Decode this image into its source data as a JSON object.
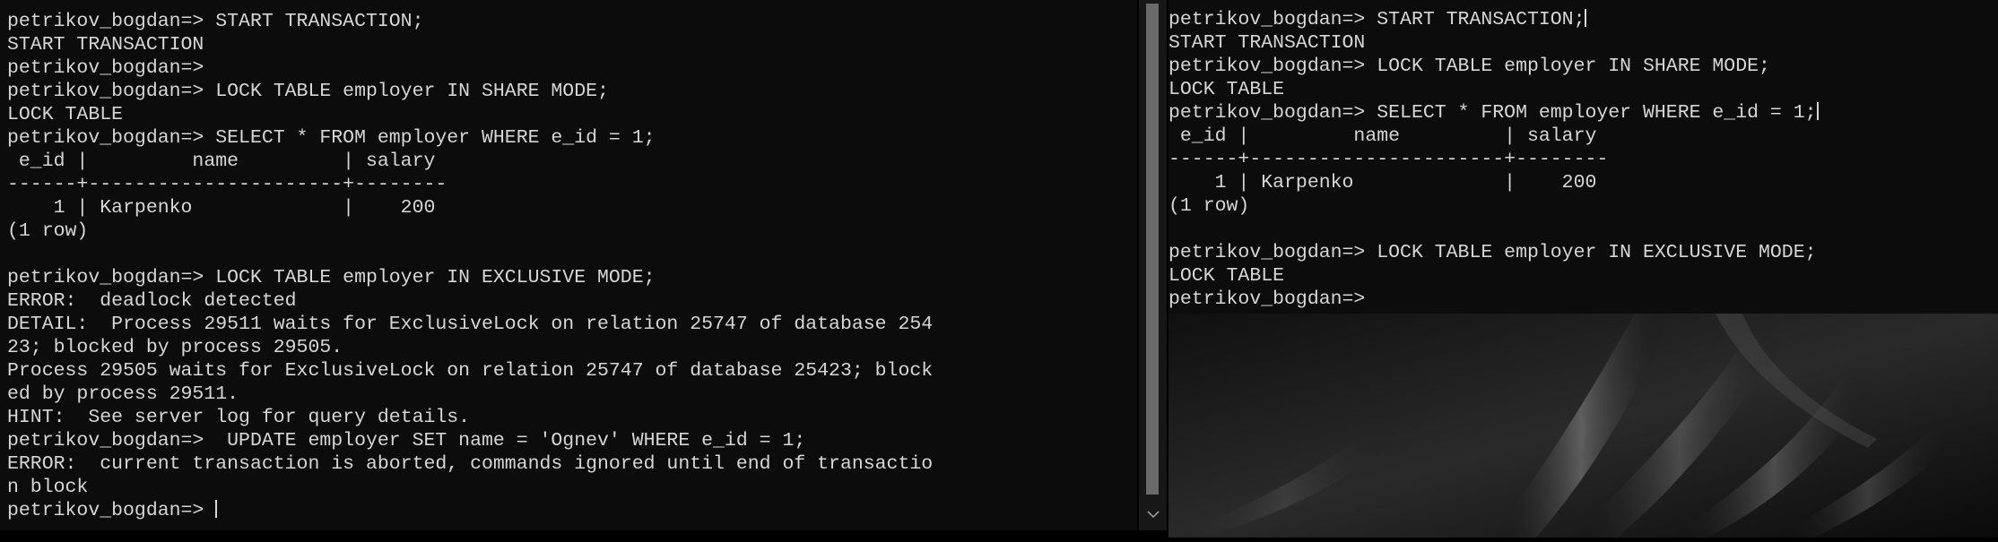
{
  "left_terminal": {
    "lines": [
      "petrikov_bogdan=> START TRANSACTION;",
      "START TRANSACTION",
      "petrikov_bogdan=>",
      "petrikov_bogdan=> LOCK TABLE employer IN SHARE MODE;",
      "LOCK TABLE",
      "petrikov_bogdan=> SELECT * FROM employer WHERE e_id = 1;",
      " e_id |         name         | salary",
      "------+----------------------+--------",
      "    1 | Karpenko             |    200",
      "(1 row)",
      "",
      "petrikov_bogdan=> LOCK TABLE employer IN EXCLUSIVE MODE;",
      "ERROR:  deadlock detected",
      "DETAIL:  Process 29511 waits for ExclusiveLock on relation 25747 of database 254",
      "23; blocked by process 29505.",
      "Process 29505 waits for ExclusiveLock on relation 25747 of database 25423; block",
      "ed by process 29511.",
      "HINT:  See server log for query details.",
      "petrikov_bogdan=>  UPDATE employer SET name = 'Ognev' WHERE e_id = 1;",
      "ERROR:  current transaction is aborted, commands ignored until end of transactio",
      "n block"
    ],
    "prompt": "petrikov_bogdan=> "
  },
  "right_terminal": {
    "line_1": "petrikov_bogdan=> START TRANSACTION;",
    "lines_mid": [
      "START TRANSACTION",
      "petrikov_bogdan=> LOCK TABLE employer IN SHARE MODE;",
      "LOCK TABLE"
    ],
    "line_select": "petrikov_bogdan=> SELECT * FROM employer WHERE e_id = 1;",
    "lines_end": [
      " e_id |         name         | salary",
      "------+----------------------+--------",
      "    1 | Karpenko             |    200",
      "(1 row)",
      "",
      "petrikov_bogdan=> LOCK TABLE employer IN EXCLUSIVE MODE;",
      "LOCK TABLE",
      "petrikov_bogdan=>"
    ]
  },
  "scrollbar": {
    "down_icon": "chevron-down-icon"
  }
}
